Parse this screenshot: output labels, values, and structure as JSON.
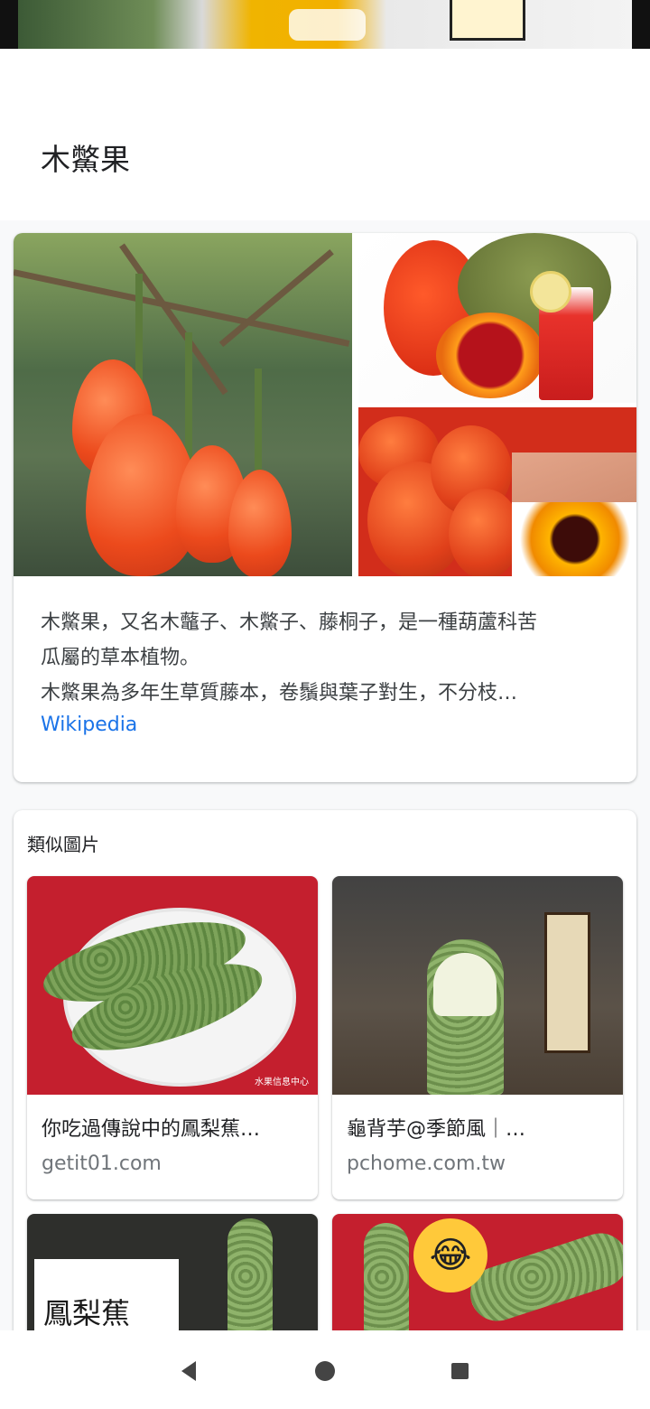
{
  "query": {
    "title": "木鱉果"
  },
  "knowledge_panel": {
    "description_line1": "木鱉果，又名木虌子、木鱉子、藤桐子，是一種葫蘆科苦",
    "description_line2": "瓜屬的草本植物。",
    "description_line3": "木鱉果為多年生草質藤本，卷鬚與葉子對生，不分枝…",
    "source_link": "Wikipedia"
  },
  "similar_images": {
    "title": "類似圖片",
    "items": [
      {
        "caption": "你吃過傳說中的鳳梨蕉…",
        "site": "getit01.com",
        "watermark": "水果信息中心"
      },
      {
        "caption": "龜背芋@季節風｜…",
        "site": "pchome.com.tw"
      },
      {
        "sign_text": "鳳梨蕉"
      },
      {
        "emoji": "😂"
      }
    ]
  },
  "navbar": {
    "buttons": [
      "back",
      "home",
      "recents"
    ]
  }
}
